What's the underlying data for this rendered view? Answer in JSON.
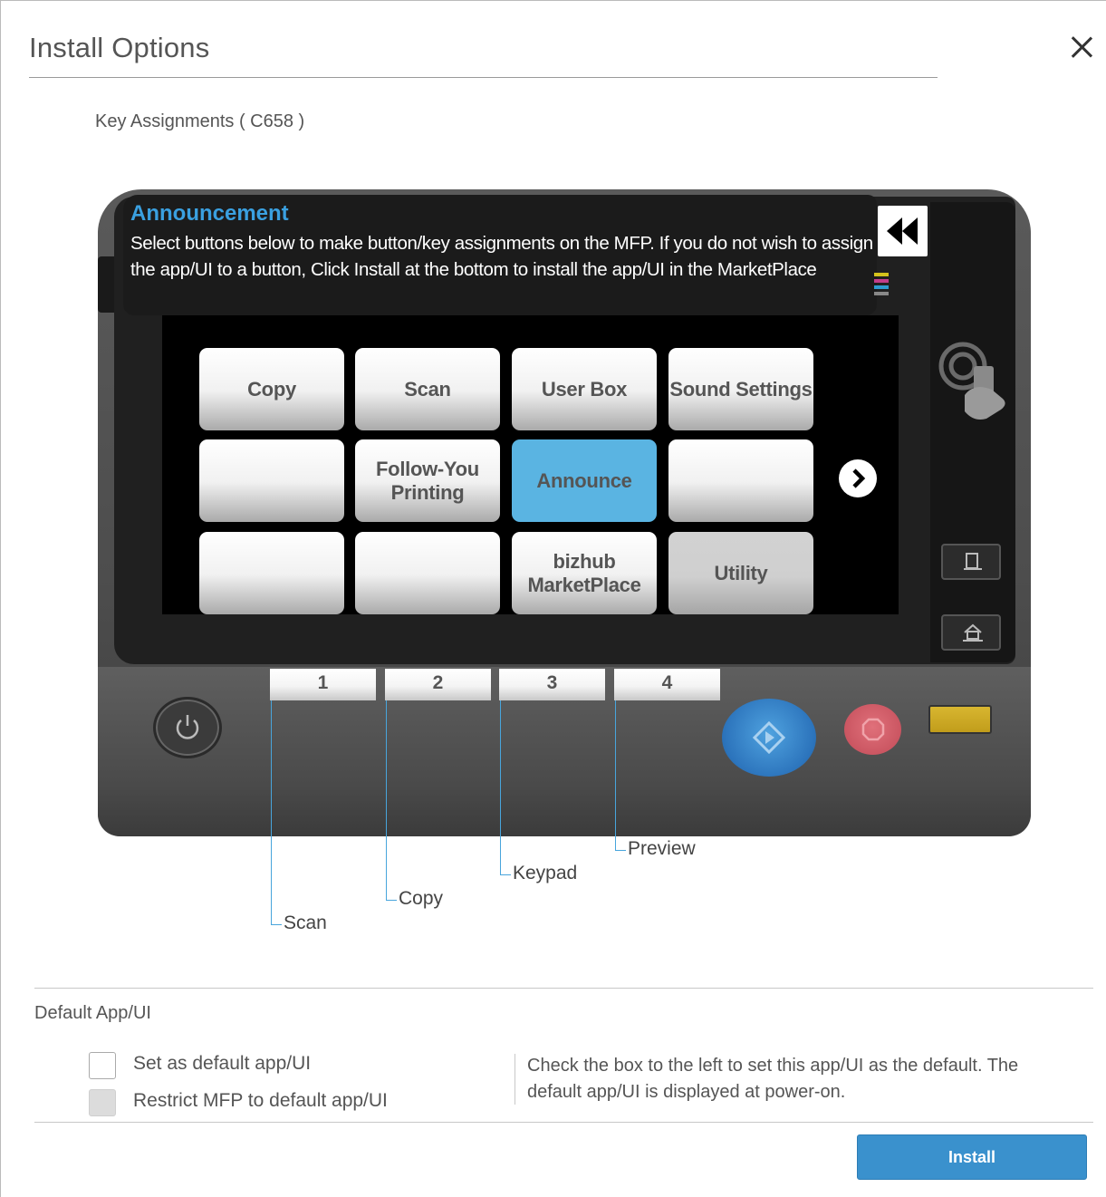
{
  "dialog": {
    "title": "Install Options",
    "close_icon": "close-icon"
  },
  "key_assignments": {
    "heading": "Key Assignments ( C658 )"
  },
  "announcement": {
    "title": "Announcement",
    "text": "Select buttons below to make button/key assignments on the MFP. If you do not wish to assign the app/UI to a button, Click Install at the bottom to install the app/UI in the MarketPlace"
  },
  "screen_buttons": [
    "Copy",
    "Scan",
    "User Box",
    "Sound Settings",
    "",
    "Follow-You Printing",
    "Announce",
    "",
    "",
    "",
    "bizhub MarketPlace",
    "Utility"
  ],
  "selected_button": "Announce",
  "hard_keys": [
    "1",
    "2",
    "3",
    "4"
  ],
  "callouts": [
    "Scan",
    "Copy",
    "Keypad",
    "Preview"
  ],
  "colors": {
    "accent": "#3a91cd",
    "announcement_title": "#3aa0e0",
    "selected_button": "#5ab4e2",
    "callout_line": "#48a5dc"
  },
  "default_app": {
    "heading": "Default App/UI",
    "set_default_label": "Set as default app/UI",
    "restrict_label": "Restrict MFP to default app/UI",
    "set_default_checked": false,
    "restrict_checked": false,
    "restrict_disabled": true,
    "help_text": "Check the box to the left to set this app/UI as the default. The default app/UI is displayed at power-on."
  },
  "install_label": "Install"
}
